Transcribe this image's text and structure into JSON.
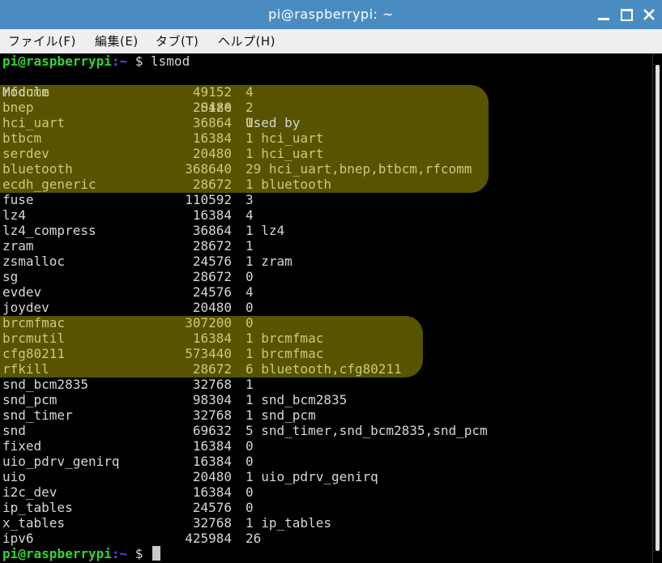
{
  "window": {
    "title": "pi@raspberrypi: ~"
  },
  "menu": [
    "ファイル(F)",
    "編集(E)",
    "タブ(T)",
    "ヘルプ(H)"
  ],
  "prompt": {
    "user_host": "pi@raspberrypi",
    "path": ":~",
    "symbol": " $ ",
    "command": "lsmod"
  },
  "header": {
    "module": "Module",
    "size": "Size",
    "used_by": "Used by"
  },
  "modules": [
    {
      "name": "rfcomm",
      "size": "49152",
      "used": "4"
    },
    {
      "name": "bnep",
      "size": "20480",
      "used": "2"
    },
    {
      "name": "hci_uart",
      "size": "36864",
      "used": "1"
    },
    {
      "name": "btbcm",
      "size": "16384",
      "used": "1 hci_uart"
    },
    {
      "name": "serdev",
      "size": "20480",
      "used": "1 hci_uart"
    },
    {
      "name": "bluetooth",
      "size": "368640",
      "used": "29 hci_uart,bnep,btbcm,rfcomm"
    },
    {
      "name": "ecdh_generic",
      "size": "28672",
      "used": "1 bluetooth"
    },
    {
      "name": "fuse",
      "size": "110592",
      "used": "3"
    },
    {
      "name": "lz4",
      "size": "16384",
      "used": "4"
    },
    {
      "name": "lz4_compress",
      "size": "36864",
      "used": "1 lz4"
    },
    {
      "name": "zram",
      "size": "28672",
      "used": "1"
    },
    {
      "name": "zsmalloc",
      "size": "24576",
      "used": "1 zram"
    },
    {
      "name": "sg",
      "size": "28672",
      "used": "0"
    },
    {
      "name": "evdev",
      "size": "24576",
      "used": "4"
    },
    {
      "name": "joydev",
      "size": "20480",
      "used": "0"
    },
    {
      "name": "brcmfmac",
      "size": "307200",
      "used": "0"
    },
    {
      "name": "brcmutil",
      "size": "16384",
      "used": "1 brcmfmac"
    },
    {
      "name": "cfg80211",
      "size": "573440",
      "used": "1 brcmfmac"
    },
    {
      "name": "rfkill",
      "size": "28672",
      "used": "6 bluetooth,cfg80211"
    },
    {
      "name": "snd_bcm2835",
      "size": "32768",
      "used": "1"
    },
    {
      "name": "snd_pcm",
      "size": "98304",
      "used": "1 snd_bcm2835"
    },
    {
      "name": "snd_timer",
      "size": "32768",
      "used": "1 snd_pcm"
    },
    {
      "name": "snd",
      "size": "69632",
      "used": "5 snd_timer,snd_bcm2835,snd_pcm"
    },
    {
      "name": "fixed",
      "size": "16384",
      "used": "0"
    },
    {
      "name": "uio_pdrv_genirq",
      "size": "16384",
      "used": "0"
    },
    {
      "name": "uio",
      "size": "20480",
      "used": "1 uio_pdrv_genirq"
    },
    {
      "name": "i2c_dev",
      "size": "16384",
      "used": "0"
    },
    {
      "name": "ip_tables",
      "size": "24576",
      "used": "0"
    },
    {
      "name": "x_tables",
      "size": "32768",
      "used": "1 ip_tables"
    },
    {
      "name": "ipv6",
      "size": "425984",
      "used": "26"
    }
  ],
  "highlight_groups": [
    [
      "rfcomm",
      "bnep",
      "hci_uart",
      "btbcm",
      "serdev",
      "bluetooth",
      "ecdh_generic"
    ],
    [
      "brcmfmac",
      "brcmutil",
      "cfg80211",
      "rfkill"
    ]
  ],
  "colors": {
    "titlebar": "#4a8cc2",
    "highlight": "#575300",
    "prompt_user": "#2fd52f",
    "prompt_path": "#5050f0"
  }
}
